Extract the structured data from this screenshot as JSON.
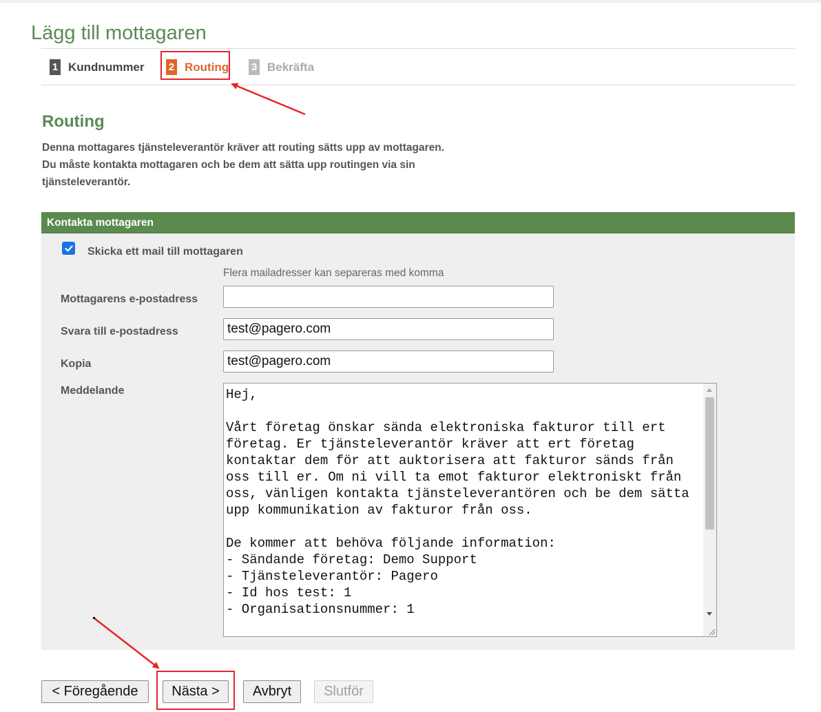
{
  "page": {
    "title": "Lägg till mottagaren"
  },
  "steps": [
    {
      "number": "1",
      "label": "Kundnummer"
    },
    {
      "number": "2",
      "label": "Routing"
    },
    {
      "number": "3",
      "label": "Bekräfta"
    }
  ],
  "routing": {
    "title": "Routing",
    "description": "Denna mottagares tjänsteleverantör kräver att routing sätts upp av mottagaren. Du måste kontakta mottagaren och be dem att sätta upp routingen via sin tjänsteleverantör."
  },
  "contact": {
    "header": "Kontakta mottagaren",
    "send_mail_label": "Skicka ett mail till mottagaren",
    "send_mail_checked": true,
    "hint": "Flera mailadresser kan separeras med komma",
    "recipient_email": {
      "label": "Mottagarens e-postadress",
      "value": ""
    },
    "reply_to": {
      "label": "Svara till e-postadress",
      "value": "test@pagero.com"
    },
    "copy": {
      "label": "Kopia",
      "value": "test@pagero.com"
    },
    "message": {
      "label": "Meddelande",
      "value": "Hej,\n\nVårt företag önskar sända elektroniska fakturor till ert företag. Er tjänsteleverantör kräver att ert företag kontaktar dem för att auktorisera att fakturor sänds från oss till er. Om ni vill ta emot fakturor elektroniskt från oss, vänligen kontakta tjänsteleverantören och be dem sätta upp kommunikation av fakturor från oss.\n\nDe kommer att behöva följande information:\n- Sändande företag: Demo Support\n- Tjänsteleverantör: Pagero\n- Id hos test: 1\n- Organisationsnummer: 1"
    }
  },
  "buttons": {
    "previous": "< Föregående",
    "next": "Nästa >",
    "cancel": "Avbryt",
    "finish": "Slutför"
  },
  "colors": {
    "accent_green": "#5a8a4e",
    "active_step": "#e0662a",
    "annotation_red": "#e8242a"
  }
}
